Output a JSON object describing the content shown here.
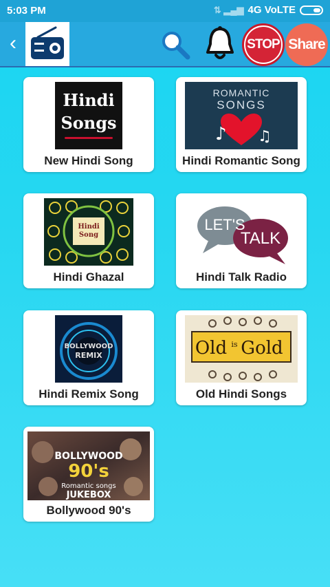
{
  "status_bar": {
    "time": "5:03 PM",
    "network": "4G VoLTE"
  },
  "app_bar": {
    "stop_label": "STOP",
    "share_label": "Share"
  },
  "cards": [
    {
      "label": "New Hindi Song",
      "thumb_line1": "Hindi",
      "thumb_line2": "Songs"
    },
    {
      "label": "Hindi Romantic Song",
      "thumb_line1": "ROMANTIC",
      "thumb_line2": "SONGS"
    },
    {
      "label": "Hindi Ghazal",
      "thumb_line1": "Hindi",
      "thumb_line2": "Song"
    },
    {
      "label": "Hindi Talk Radio",
      "thumb_line1": "LET'S",
      "thumb_line2": "TALK"
    },
    {
      "label": "Hindi Remix Song",
      "thumb_line1": "BOLLYWOOD",
      "thumb_line2": "REMIX"
    },
    {
      "label": "Old Hindi Songs",
      "thumb_line1": "Old",
      "thumb_line2": "is",
      "thumb_line3": "Gold"
    },
    {
      "label": "Bollywood 90's",
      "thumb_line1": "BOLLYWOOD",
      "thumb_line2": "90's",
      "thumb_line3": "Romantic songs",
      "thumb_line4": "JUKEBOX"
    }
  ],
  "colors": {
    "background": "#27d7f1",
    "app_bar": "#27a9df",
    "status_bar": "#1fa3d6",
    "stop": "#d42436",
    "share": "#ef6b55"
  },
  "icons": [
    "back-arrow-icon",
    "radio-icon",
    "search-icon",
    "bell-icon"
  ]
}
